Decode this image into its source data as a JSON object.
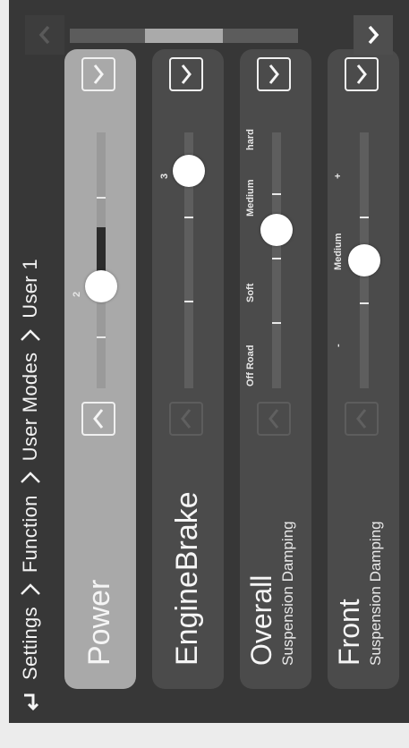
{
  "breadcrumb": {
    "items": [
      "Settings",
      "Function",
      "User Modes",
      "User 1"
    ]
  },
  "panels": [
    {
      "title": "Power",
      "subtitle": "",
      "active": true,
      "level_label": "2",
      "level_fraction": 0.4,
      "up_enabled": true,
      "down_enabled": true
    },
    {
      "title": "EngineBrake",
      "subtitle": "",
      "active": false,
      "level_label": "3",
      "level_fraction": 0.85,
      "up_enabled": true,
      "down_enabled": false
    },
    {
      "title": "Overall",
      "subtitle": "Suspension Damping",
      "active": false,
      "level_labels": [
        "Off Road",
        "Soft",
        "Medium",
        "hard"
      ],
      "level_fraction": 0.62,
      "up_enabled": true,
      "down_enabled": false
    },
    {
      "title": "Front",
      "subtitle": "Suspension Damping",
      "active": false,
      "level_labels": [
        "-",
        "Medium",
        "+"
      ],
      "level_fraction": 0.5,
      "up_enabled": true,
      "down_enabled": false
    }
  ],
  "scrollbar": {
    "position_fraction": 0.33,
    "visible_fraction": 0.34
  },
  "colors": {
    "background": "#373737",
    "panel": "#4b4b4b",
    "panel_active": "#a9a9a9",
    "accent": "#ffffff"
  }
}
